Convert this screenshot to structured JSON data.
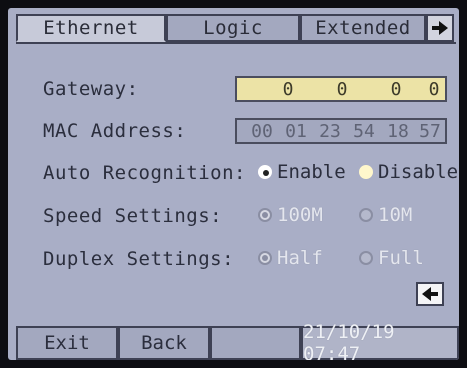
{
  "tabs": {
    "ethernet": "Ethernet",
    "logic": "Logic",
    "extended": "Extended"
  },
  "icons": {
    "next_tab": "right-arrow-icon",
    "back": "left-arrow-icon"
  },
  "gateway": {
    "label": "Gateway:",
    "octets": [
      "0",
      "0",
      "0",
      "0"
    ]
  },
  "mac": {
    "label": "MAC Address:",
    "bytes": [
      "00",
      "01",
      "23",
      "54",
      "18",
      "57"
    ]
  },
  "auto_recognition": {
    "label": "Auto Recognition:",
    "enable": "Enable",
    "disable": "Disable",
    "selected": "Enable"
  },
  "speed": {
    "label": "Speed Settings:",
    "opt1": "100M",
    "opt2": "10M",
    "selected": "100M"
  },
  "duplex": {
    "label": "Duplex Settings:",
    "opt1": "Half",
    "opt2": "Full",
    "selected": "Half"
  },
  "bottom": {
    "exit": "Exit",
    "back": "Back",
    "datetime": "21/10/19 07:47"
  },
  "colors": {
    "screen_bg": "#a9aec6",
    "gateway_field": "#ece3a6"
  }
}
